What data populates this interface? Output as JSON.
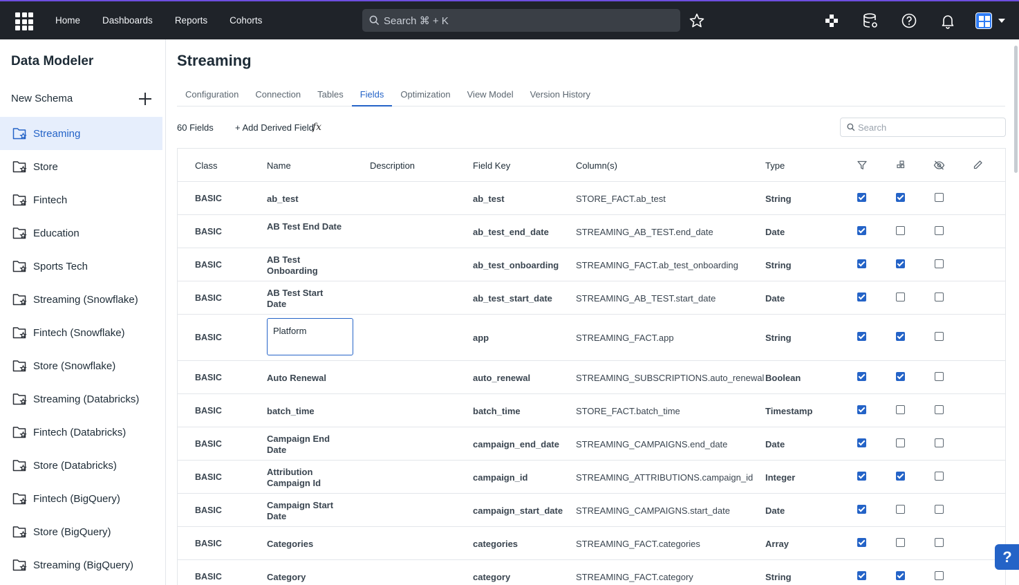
{
  "topnav": {
    "links": [
      "Home",
      "Dashboards",
      "Reports",
      "Cohorts"
    ],
    "search_placeholder": "Search ⌘ + K"
  },
  "sidebar": {
    "title": "Data Modeler",
    "new_schema": "New Schema",
    "items": [
      {
        "label": "Streaming",
        "active": true
      },
      {
        "label": "Store"
      },
      {
        "label": "Fintech"
      },
      {
        "label": "Education"
      },
      {
        "label": "Sports Tech"
      },
      {
        "label": "Streaming (Snowflake)"
      },
      {
        "label": "Fintech (Snowflake)"
      },
      {
        "label": "Store (Snowflake)"
      },
      {
        "label": "Streaming (Databricks)"
      },
      {
        "label": "Fintech (Databricks)"
      },
      {
        "label": "Store (Databricks)"
      },
      {
        "label": "Fintech (BigQuery)"
      },
      {
        "label": "Store (BigQuery)"
      },
      {
        "label": "Streaming (BigQuery)"
      }
    ]
  },
  "main": {
    "title": "Streaming",
    "tabs": [
      "Configuration",
      "Connection",
      "Tables",
      "Fields",
      "Optimization",
      "View Model",
      "Version History"
    ],
    "active_tab": "Fields",
    "field_count": "60 Fields",
    "add_derived": "+ Add Derived Field",
    "fx_symbol": "fx",
    "search_placeholder": "Search",
    "columns": [
      "Class",
      "Name",
      "Description",
      "Field Key",
      "Column(s)",
      "Type"
    ],
    "rows": [
      {
        "class": "BASIC",
        "name": "ab_test",
        "key": "ab_test",
        "column": "STORE_FACT.ab_test",
        "type": "String",
        "filter": true,
        "group": true,
        "hidden": false
      },
      {
        "class": "BASIC",
        "name": "AB Test End Date",
        "key": "ab_test_end_date",
        "column": "STREAMING_AB_TEST.end_date",
        "type": "Date",
        "filter": true,
        "group": false,
        "hidden": false
      },
      {
        "class": "BASIC",
        "name": "AB Test Onboarding",
        "key": "ab_test_onboarding",
        "column": "STREAMING_FACT.ab_test_onboarding",
        "type": "String",
        "filter": true,
        "group": true,
        "hidden": false
      },
      {
        "class": "BASIC",
        "name": "AB Test Start Date",
        "key": "ab_test_start_date",
        "column": "STREAMING_AB_TEST.start_date",
        "type": "Date",
        "filter": true,
        "group": false,
        "hidden": false
      },
      {
        "class": "BASIC",
        "name": "Platform",
        "key": "app",
        "column": "STREAMING_FACT.app",
        "type": "String",
        "filter": true,
        "group": true,
        "hidden": false,
        "editing": true
      },
      {
        "class": "BASIC",
        "name": "Auto Renewal",
        "key": "auto_renewal",
        "column": "STREAMING_SUBSCRIPTIONS.auto_renewal",
        "type": "Boolean",
        "filter": true,
        "group": true,
        "hidden": false
      },
      {
        "class": "BASIC",
        "name": "batch_time",
        "key": "batch_time",
        "column": "STORE_FACT.batch_time",
        "type": "Timestamp",
        "filter": true,
        "group": false,
        "hidden": false
      },
      {
        "class": "BASIC",
        "name": "Campaign End Date",
        "key": "campaign_end_date",
        "column": "STREAMING_CAMPAIGNS.end_date",
        "type": "Date",
        "filter": true,
        "group": false,
        "hidden": false
      },
      {
        "class": "BASIC",
        "name": "Attribution Campaign Id",
        "key": "campaign_id",
        "column": "STREAMING_ATTRIBUTIONS.campaign_id",
        "type": "Integer",
        "filter": true,
        "group": true,
        "hidden": false
      },
      {
        "class": "BASIC",
        "name": "Campaign Start Date",
        "key": "campaign_start_date",
        "column": "STREAMING_CAMPAIGNS.start_date",
        "type": "Date",
        "filter": true,
        "group": false,
        "hidden": false
      },
      {
        "class": "BASIC",
        "name": "Categories",
        "key": "categories",
        "column": "STREAMING_FACT.categories",
        "type": "Array",
        "filter": true,
        "group": false,
        "hidden": false
      },
      {
        "class": "BASIC",
        "name": "Category",
        "key": "category",
        "column": "STREAMING_FACT.category",
        "type": "String",
        "filter": true,
        "group": true,
        "hidden": false
      }
    ]
  },
  "help_label": "?"
}
